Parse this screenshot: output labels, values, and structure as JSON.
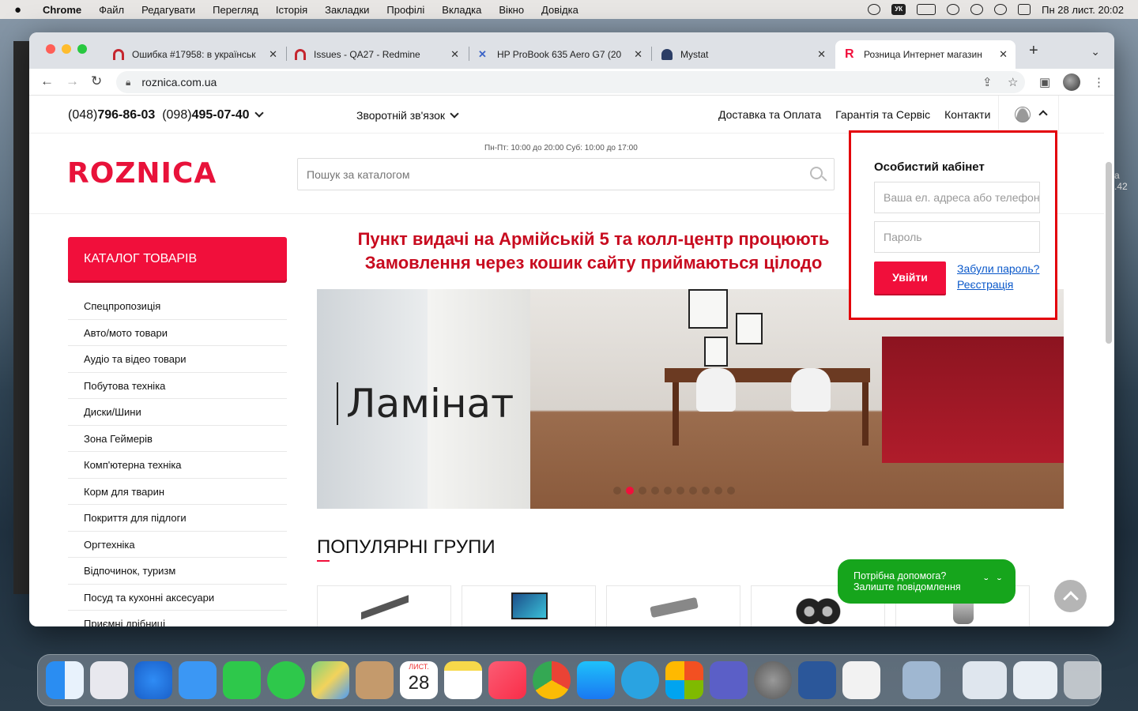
{
  "menubar": {
    "app": "Chrome",
    "items": [
      "Файл",
      "Редагувати",
      "Перегляд",
      "Історія",
      "Закладки",
      "Профілі",
      "Вкладка",
      "Вікно",
      "Довідка"
    ],
    "keyboard": "УК",
    "clock": "Пн 28 лист.  20:02"
  },
  "browser": {
    "tabs": [
      {
        "label": "Ошибка #17958: в українськ",
        "icon": "redmine-icon",
        "color": "#c5262f"
      },
      {
        "label": "Issues - QA27 - Redmine",
        "icon": "redmine-icon",
        "color": "#c5262f"
      },
      {
        "label": "HP ProBook 635 Aero G7 (20",
        "icon": "hp-icon",
        "color": "#3a63c7"
      },
      {
        "label": "Mystat",
        "icon": "mystat-icon",
        "color": "#2c3e66"
      },
      {
        "label": "Розница Интернет магазин",
        "icon": "roznica-icon",
        "color": "#f10f3b"
      }
    ],
    "url": "roznica.com.ua"
  },
  "site": {
    "phone1_code": "(048)",
    "phone1": "796-86-03",
    "phone2_code": "(098)",
    "phone2": "495-07-40",
    "feedback": "Зворотній зв'язок",
    "top_links": [
      "Доставка та Оплата",
      "Гарантія та Сервіс",
      "Контакти"
    ],
    "hours": "Пн-Пт: 10:00 до 20:00 Суб: 10:00 до 17:00",
    "logo": "ROZNICA",
    "search_placeholder": "Пошук за каталогом",
    "catalog_button": "КАТАЛОГ ТОВАРІВ",
    "categories": [
      "Спецпропозиція",
      "Авто/мото товари",
      "Аудіо та відео товари",
      "Побутова техніка",
      "Диски/Шини",
      "Зона Геймерів",
      "Комп'ютерна техніка",
      "Корм для тварин",
      "Покриття для підлоги",
      "Оргтехніка",
      "Відпочинок, туризм",
      "Посуд та кухонні аксесуари",
      "Приємні дрібниці"
    ],
    "promo_line1": "Пункт видачі на Армійській 5 та колл-центр процюють",
    "promo_line2": "Замовлення через кошик сайту приймаються цілодо",
    "banner_title": "Ламінат",
    "popular_title": "ПОПУЛЯРНІ ГРУПИ",
    "chat_line1": "Потрібна допомога?",
    "chat_line2": "Залиште повідомлення",
    "chat_face": "˘ ˘"
  },
  "login": {
    "title": "Особистий кабінет",
    "email_placeholder": "Ваша ел. адреса або телефон",
    "password_placeholder": "Пароль",
    "submit": "Увійти",
    "forgot": "Забули пароль?",
    "register": "Реєстрація",
    "highlight_color": "#e3000b"
  },
  "desktop_edge": {
    "text1": "а",
    "text2": ".42"
  },
  "dock": {
    "calendar_month": "ЛИСТ.",
    "calendar_day": "28"
  }
}
